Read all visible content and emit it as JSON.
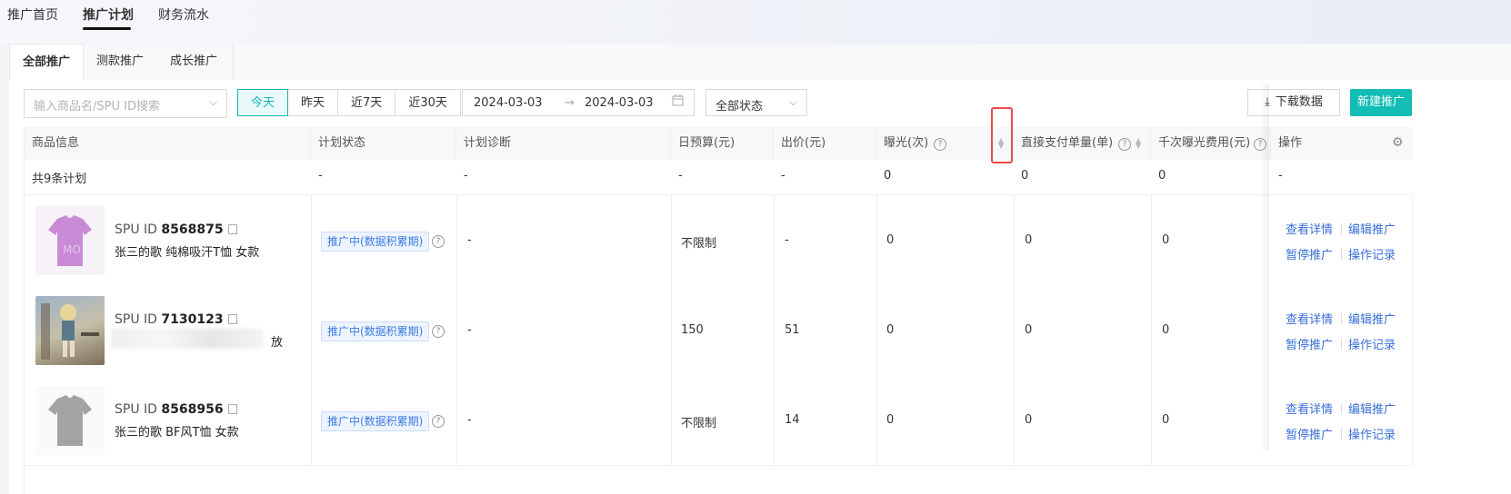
{
  "topnav": {
    "items": [
      "推广首页",
      "推广计划",
      "财务流水"
    ],
    "active": "推广计划"
  },
  "subtabs": [
    "全部推广",
    "测款推广",
    "成长推广"
  ],
  "filters": {
    "search_placeholder": "输入商品名/SPU ID搜索",
    "date_buttons": [
      "今天",
      "昨天",
      "近7天",
      "近30天"
    ],
    "date_start": "2024-03-03",
    "date_end": "2024-03-03",
    "status": "全部状态",
    "download_label": "下载数据",
    "new_label": "新建推广"
  },
  "table": {
    "headers": [
      "商品信息",
      "计划状态",
      "计划诊断",
      "日预算(元)",
      "出价(元)",
      "曝光(次)",
      "直接支付单量(单)",
      "千次曝光费用(元)",
      "操作"
    ],
    "summary": [
      "共9条计划",
      "-",
      "-",
      "-",
      "-",
      "0",
      "0",
      "0",
      "-"
    ],
    "rows": [
      {
        "spu_label": "SPU ID",
        "spu_id": "8568875",
        "name": "张三的歌 纯棉吸汗T恤 女款",
        "status": "推广中(数据积累期)",
        "diagnosis": "-",
        "budget": "不限制",
        "bid": "-",
        "exposure": "0",
        "orders": "0",
        "cpm": "0",
        "thumb": "pink-tshirt"
      },
      {
        "spu_label": "SPU ID",
        "spu_id": "7130123",
        "name": "放",
        "status": "推广中(数据积累期)",
        "diagnosis": "-",
        "budget": "150",
        "bid": "51",
        "exposure": "0",
        "orders": "0",
        "cpm": "0",
        "thumb": "anime-figure"
      },
      {
        "spu_label": "SPU ID",
        "spu_id": "8568956",
        "name": "张三的歌 BF风T恤 女款",
        "status": "推广中(数据积累期)",
        "diagnosis": "-",
        "budget": "不限制",
        "bid": "14",
        "exposure": "0",
        "orders": "0",
        "cpm": "0",
        "thumb": "gray-tshirt"
      }
    ],
    "ops": {
      "view": "查看详情",
      "edit": "编辑推广",
      "pause": "暂停推广",
      "log": "操作记录"
    }
  },
  "colors": {
    "accent": "#12bdb5",
    "link": "#3a6fd8",
    "tag": "#3b7be6",
    "highlight": "#e84a4a"
  }
}
